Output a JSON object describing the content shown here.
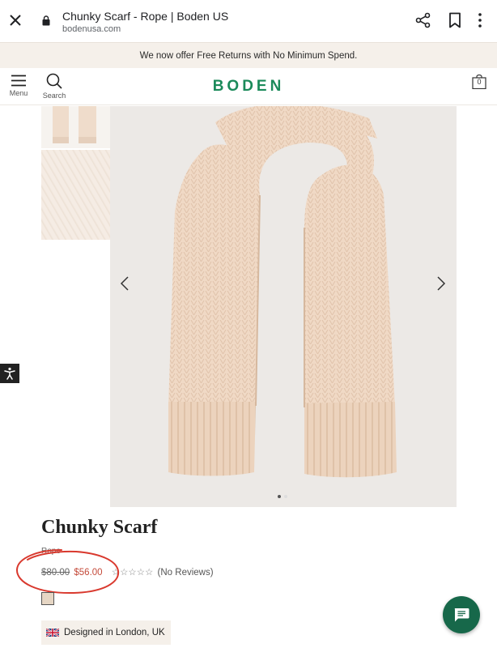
{
  "browser": {
    "tab_title": "Chunky Scarf - Rope | Boden US",
    "url": "bodenusa.com"
  },
  "announcement": {
    "text": "We now offer Free Returns with No Minimum Spend."
  },
  "header": {
    "menu_label": "Menu",
    "search_label": "Search",
    "logo": "BODEN",
    "bag_count": "0"
  },
  "gallery": {
    "slide_count": 2,
    "active_slide": 1
  },
  "product": {
    "name": "Chunky Scarf",
    "color": "Rope",
    "price_was": "$80.00",
    "price_now": "$56.00",
    "rating_stars": "☆☆☆☆☆",
    "reviews_text": "(No Reviews)",
    "designed_in": "Designed in London, UK"
  },
  "colors": {
    "brand": "#1b8a5a",
    "sale": "#c44a3a",
    "chat": "#17684a",
    "annotation": "#d9392e"
  },
  "icons": {
    "close": "close-icon",
    "lock": "lock-icon",
    "share": "share-icon",
    "bookmark": "bookmark-icon",
    "more": "more-vert-icon",
    "menu": "hamburger-icon",
    "search": "search-icon",
    "bag": "shopping-bag-icon",
    "accessibility": "accessibility-icon",
    "chat": "chat-icon",
    "flag": "uk-flag-icon"
  }
}
